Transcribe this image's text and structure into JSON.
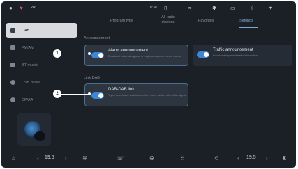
{
  "status_bar": {
    "temperature": "24°",
    "time": "10:30"
  },
  "sidebar": {
    "items": [
      {
        "label": "DAB",
        "icon": "radio-icon",
        "active": true
      },
      {
        "label": "FM/AM",
        "icon": "radio-icon",
        "active": false
      },
      {
        "label": "BT music",
        "icon": "bluetooth-icon",
        "active": false
      },
      {
        "label": "USB music",
        "icon": "usb-icon",
        "active": false
      },
      {
        "label": "CP/AA",
        "icon": "carplay-icon",
        "active": false
      }
    ]
  },
  "tabs": [
    {
      "label": "Program type",
      "active": false
    },
    {
      "label": "All radio stations",
      "active": false
    },
    {
      "label": "Favorites",
      "active": false
    },
    {
      "label": "Settings",
      "active": true
    }
  ],
  "sections": {
    "announcement": {
      "title": "Announcement",
      "cards": [
        {
          "title": "Alarm announcement",
          "desc": "Broadcast national/regional or major unexpected event events",
          "enabled": true
        },
        {
          "title": "Traffic announcement",
          "desc": "Broadcast important traffic information",
          "enabled": true
        }
      ]
    },
    "link_dab": {
      "title": "Link DAB",
      "cards": [
        {
          "title": "DAB-DAB link",
          "desc": "Try to search and switch to another same station with better signal",
          "enabled": true
        }
      ]
    }
  },
  "callouts": [
    "1",
    "2"
  ],
  "bottom_bar": {
    "left_temp": "19.5",
    "right_temp": "19.5"
  }
}
